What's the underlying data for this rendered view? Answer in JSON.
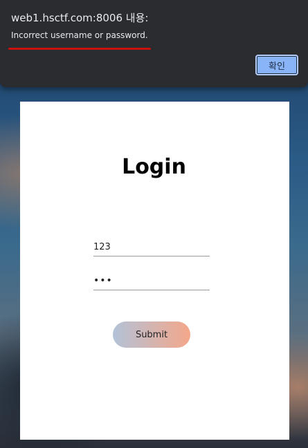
{
  "alert": {
    "title": "web1.hsctf.com:8006 내용:",
    "message": "Incorrect username or password.",
    "ok_label": "확인"
  },
  "login": {
    "title": "Login",
    "username_value": "123",
    "password_value": "123",
    "submit_label": "Submit"
  }
}
